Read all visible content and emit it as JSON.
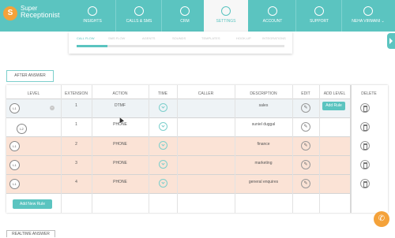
{
  "brand": {
    "line1": "Super",
    "line2": "Receptionist",
    "logo_glyph": "S"
  },
  "nav": {
    "items": [
      {
        "label": "INSIGHTS",
        "icon": "insights-icon"
      },
      {
        "label": "CALLS & SMS",
        "icon": "calls-icon"
      },
      {
        "label": "CRM",
        "icon": "crm-icon"
      },
      {
        "label": "SETTINGS",
        "icon": "settings-icon",
        "active": true
      },
      {
        "label": "ACCOUNT",
        "icon": "account-icon"
      },
      {
        "label": "SUPPORT",
        "icon": "support-icon"
      }
    ],
    "user": "NEHA VIRMANI"
  },
  "subnav": {
    "tabs": [
      "CALL FLOW",
      "SMS FLOW",
      "AGENTS",
      "SOUNDS",
      "TEMPLATES",
      "HOOK-UP",
      "INTEGRATIONS"
    ],
    "active": "CALL FLOW",
    "progress": 0.15
  },
  "after_answer_label": "AFTER ANSWER",
  "table": {
    "headers": [
      "LEVEL",
      "EXTENSION",
      "ACTION",
      "TIME",
      "CALLER",
      "DESCRIPTION",
      "EDIT",
      "ADD LEVEL",
      "DELETE"
    ],
    "rows": [
      {
        "level": "L1",
        "extension": "1",
        "action": "DTMF",
        "description": "sales",
        "collapse": "−"
      },
      {
        "level": "L2",
        "extension": "1",
        "action": "PHONE",
        "description": "suniel duggal"
      },
      {
        "level": "L1",
        "extension": "2",
        "action": "PHONE",
        "description": "finance"
      },
      {
        "level": "L1",
        "extension": "3",
        "action": "PHONE",
        "description": "marketing"
      },
      {
        "level": "L1",
        "extension": "4",
        "action": "PHONE",
        "description": "general enquires"
      }
    ],
    "add_rule_label": "Add Rule",
    "add_new_rule_label": "Add New Rule",
    "edit_glyph": "✎"
  },
  "realtime_label": "REALTIME ANSWER",
  "colors": {
    "accent": "#5bc4c0",
    "row_highlight": "#fbe3d6",
    "row_alt": "#eef3f6",
    "fab": "#f4a23a"
  },
  "fab_glyph": "✆"
}
